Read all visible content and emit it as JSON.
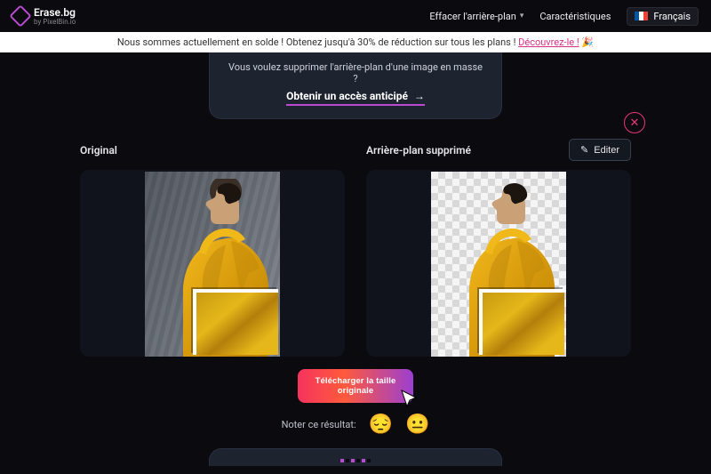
{
  "nav": {
    "brand_title": "Erase.bg",
    "brand_subtitle": "by PixelBin.io",
    "links": {
      "erase": "Effacer l'arrière-plan",
      "features": "Caractéristiques"
    },
    "language_label": "Français"
  },
  "sale": {
    "text": "Nous sommes actuellement en solde ! Obtenez jusqu'à 30% de réduction sur tous les plans ! ",
    "cta": "Découvrez-le !",
    "emoji": "🎉"
  },
  "bulk": {
    "line1": "Vous voulez supprimer l'arrière-plan d'une image en masse",
    "line2": "?",
    "cta": "Obtenir un accès anticipé"
  },
  "compare": {
    "original_label": "Original",
    "removed_label": "Arrière-plan supprimé",
    "edit_label": "Editer"
  },
  "download": {
    "line1": "Télécharger la taille",
    "line2": "originale"
  },
  "rating": {
    "prompt": "Noter ce résultat:",
    "sad": "😔",
    "neutral": "😐"
  }
}
